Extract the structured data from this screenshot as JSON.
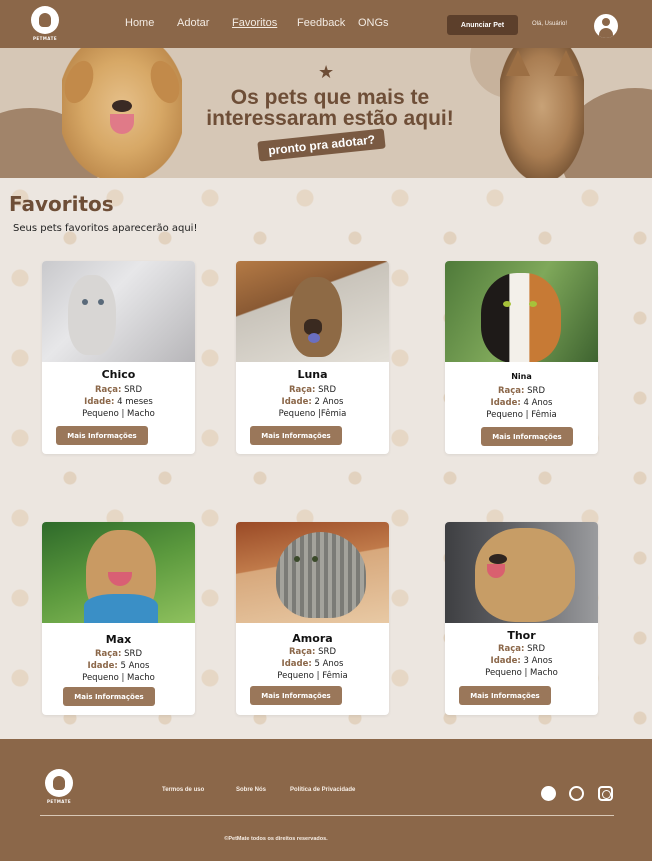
{
  "header": {
    "brand": "PETMATE",
    "nav": [
      "Home",
      "Adotar",
      "Favoritos",
      "Feedback",
      "ONGs"
    ],
    "active_nav": "Favoritos",
    "announce_button": "Anunciar Pet",
    "greeting": "Olá, Usuário!"
  },
  "banner": {
    "title_line1": "Os pets que mais te",
    "title_line2": "interessaram estão aqui!",
    "tag": "pronto pra adotar?"
  },
  "main": {
    "title": "Favoritos",
    "subtitle": "Seus pets favoritos aparecerão aqui!"
  },
  "labels": {
    "breed": "Raça:",
    "age": "Idade:",
    "more_info": "Mais Informações"
  },
  "pets": [
    {
      "name": "Chico",
      "breed": "SRD",
      "age": "4 meses",
      "details": "Pequeno | Macho"
    },
    {
      "name": "Luna",
      "breed": "SRD",
      "age": "2 Anos",
      "details": "Pequeno |Fêmia"
    },
    {
      "name": "Nina",
      "breed": "SRD",
      "age": "4 Anos",
      "details": "Pequeno | Fêmia"
    },
    {
      "name": "Max",
      "breed": "SRD",
      "age": "5 Anos",
      "details": "Pequeno | Macho"
    },
    {
      "name": "Amora",
      "breed": "SRD",
      "age": "5 Anos",
      "details": "Pequeno | Fêmia"
    },
    {
      "name": "Thor",
      "breed": "SRD",
      "age": "3 Anos",
      "details": "Pequeno | Macho"
    }
  ],
  "footer": {
    "brand": "PETMATE",
    "links": [
      "Termos de uso",
      "Sobre Nós",
      "Política de Privacidade"
    ],
    "social": [
      "facebook-icon",
      "whatsapp-icon",
      "instagram-icon"
    ],
    "copyright": "©PetMate todos os direitos reservados."
  },
  "colors": {
    "primary": "#8b6749",
    "button": "#9a775a",
    "background": "#ece6e0",
    "banner": "#d6c7b6"
  }
}
